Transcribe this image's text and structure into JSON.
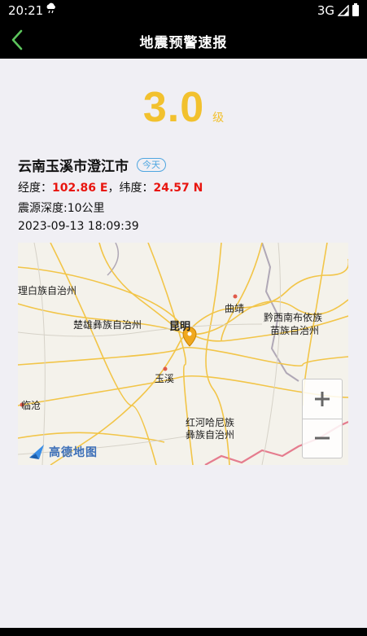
{
  "status_bar": {
    "time": "20:21",
    "network": "3G"
  },
  "header": {
    "title": "地震预警速报"
  },
  "magnitude": {
    "value": "3.0",
    "unit": "级"
  },
  "event": {
    "location": "云南玉溪市澄江市",
    "badge": "今天",
    "lon_label": "经度：",
    "lon_value": "102.86 E",
    "lat_label": "，纬度：",
    "lat_value": "24.57 N",
    "depth": "震源深度:10公里",
    "time": "2023-09-13 18:09:39"
  },
  "map": {
    "labels": {
      "dali": "理白族自治州",
      "chuxiong": "楚雄彝族自治州",
      "kunming": "昆明",
      "qujing": "曲靖",
      "qiannan_1": "黔西南布依族",
      "qiannan_2": "苗族自治州",
      "yuxi": "玉溪",
      "lincang": "临沧",
      "honghe_1": "红河哈尼族",
      "honghe_2": "彝族自治州"
    },
    "logo_text": "高德地图",
    "zoom_in_label": "+",
    "zoom_out_label": "−"
  },
  "colors": {
    "accent": "#f2c12e",
    "coordinate": "#e8150f",
    "badge": "#4fa6e0"
  },
  "icons": {
    "back": "chevron-left-icon",
    "weather": "cloud-rain-icon",
    "marker": "location-pin-icon"
  }
}
